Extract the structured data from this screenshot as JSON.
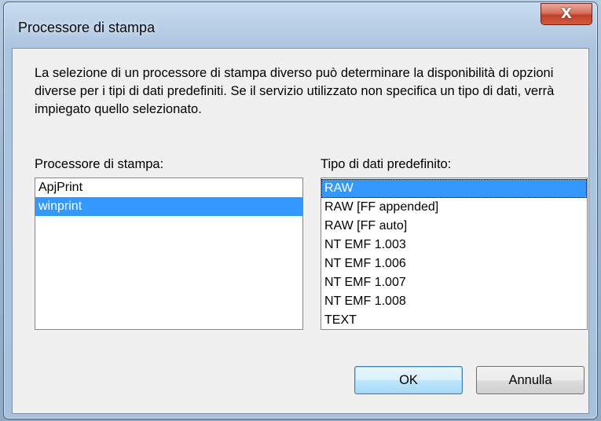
{
  "window": {
    "title": "Processore di stampa",
    "close_glyph": "X"
  },
  "description": "La selezione di un processore di stampa diverso può determinare la disponibilità di opzioni diverse per i tipi di dati predefiniti. Se il servizio utilizzato non specifica un tipo di dati, verrà impiegato quello selezionato.",
  "processor_list": {
    "label": "Processore di stampa:",
    "items": [
      "ApjPrint",
      "winprint"
    ],
    "selected_index": 1
  },
  "datatype_list": {
    "label": "Tipo di dati predefinito:",
    "items": [
      "RAW",
      "RAW [FF appended]",
      "RAW [FF auto]",
      "NT EMF 1.003",
      "NT EMF 1.006",
      "NT EMF 1.007",
      "NT EMF 1.008",
      "TEXT"
    ],
    "selected_index": 0
  },
  "buttons": {
    "ok": "OK",
    "cancel": "Annulla"
  },
  "colors": {
    "selection": "#3399ff",
    "close_button": "#c0422a"
  }
}
